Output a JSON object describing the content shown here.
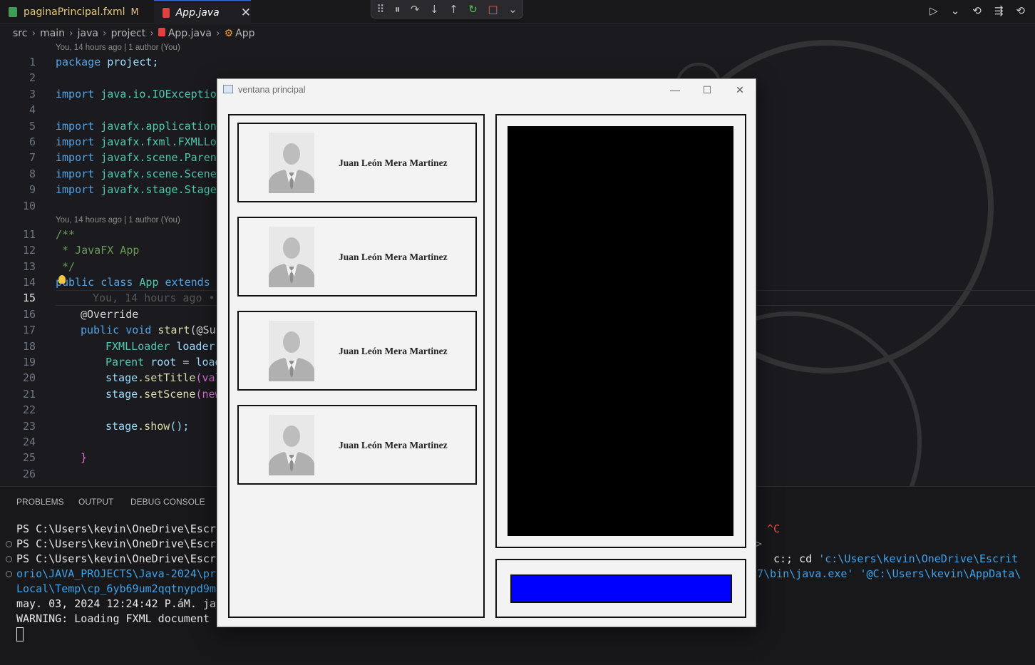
{
  "tabs": [
    {
      "label": "paginaPrincipal.fxml",
      "badge": "M"
    },
    {
      "label": "App.java",
      "close": "✕"
    }
  ],
  "debug_toolbar": {
    "grip": "⠿",
    "pause": "⏸",
    "step_over": "↷",
    "step_into": "↓",
    "step_out": "↑",
    "restart": "↻",
    "stop": "□",
    "dropdown": "⌄"
  },
  "run_tools": {
    "run": "▷",
    "run_dropdown": "⌄",
    "history": "⟲",
    "branch": "⇶",
    "timeline": "⟲"
  },
  "breadcrumb": [
    "src",
    "main",
    "java",
    "project",
    "App.java",
    "App"
  ],
  "editor": {
    "blame1": "You, 14 hours ago | 1 author (You)",
    "blame2": "You, 14 hours ago | 1 author (You)",
    "inline_blame": "You, 14 hours ago •",
    "line_numbers": [
      "1",
      "2",
      "3",
      "4",
      "5",
      "6",
      "7",
      "8",
      "9",
      "10",
      "11",
      "12",
      "13",
      "14",
      "15",
      "16",
      "17",
      "18",
      "19",
      "20",
      "21",
      "22",
      "23",
      "24",
      "25",
      "26"
    ],
    "lines": {
      "l1a": "package",
      "l1b": " project;",
      "l3a": "import",
      "l3b": " java.io.IOException",
      "l5a": "import",
      "l5b": " javafx.application.",
      "l6a": "import",
      "l6b": " javafx.fxml.FXMLLoa",
      "l7a": "import",
      "l7b": " javafx.scene.Parent",
      "l8a": "import",
      "l8b": " javafx.scene.Scene;",
      "l9a": "import",
      "l9b": " javafx.stage.Stage;",
      "l11": "/**",
      "l12": " * JavaFX App",
      "l13": " */",
      "l14a": "public",
      "l14b": " class",
      "l14c": " App",
      "l14d": " extends",
      "l14e": " A",
      "l16": "@Override",
      "l17a": "public",
      "l17b": " void",
      "l17c": " start",
      "l17d": "(@Sup",
      "l18a": "FXMLLoader",
      "l18b": " loader",
      "l19a": "Parent",
      "l19b": " root",
      "l19c": " = ",
      "l19d": "load",
      "l20a": "stage",
      "l20b": ".setTitle",
      "l20c": "(val",
      "l21a": "stage",
      "l21b": ".setScene",
      "l21c": "(new",
      "l23a": "stage",
      "l23b": ".show",
      "l23c": "();",
      "l25": "}"
    }
  },
  "panel": {
    "tabs": [
      "PROBLEMS",
      "OUTPUT",
      "DEBUG CONSOLE"
    ],
    "terminal": [
      "PS C:\\Users\\kevin\\OneDrive\\Escr",
      "PS C:\\Users\\kevin\\OneDrive\\Escr",
      "PS C:\\Users\\kevin\\OneDrive\\Escr",
      "orio\\JAVA_PROJECTS\\Java-2024\\pr",
      "Local\\Temp\\cp_6yb69um2qqtnypd9m",
      "may. 03, 2024 12:24:42 P.áM. ja",
      "WARNING: Loading FXML document "
    ],
    "terminal_right": {
      "r1": "^C",
      "r2": ">",
      "r3a": "c:;",
      "r3b": " cd",
      "r3c": " 'c:\\Users\\kevin\\OneDrive\\Escrit",
      "r4": "7\\bin\\java.exe' '@C:\\Users\\kevin\\AppData\\"
    }
  },
  "fx_window": {
    "title": "ventana principal",
    "minimize": "—",
    "maximize": "☐",
    "close": "✕",
    "cards": [
      {
        "name": "Juan León Mera Martinez"
      },
      {
        "name": "Juan León Mera Martinez"
      },
      {
        "name": "Juan León Mera Martinez"
      },
      {
        "name": "Juan León Mera Martinez"
      }
    ],
    "colors": {
      "bar": "#0000ff",
      "view": "#000000"
    }
  }
}
